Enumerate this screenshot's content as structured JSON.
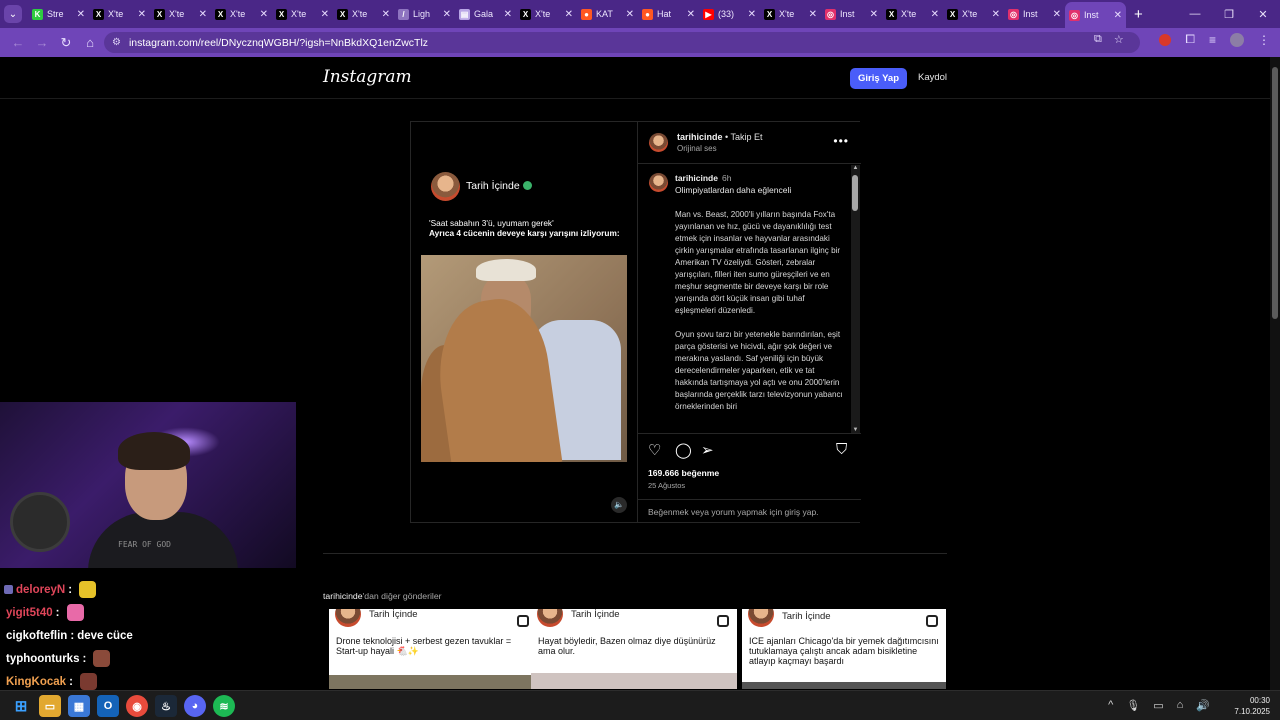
{
  "browser": {
    "tabs": [
      {
        "label": "Stre",
        "fav_color": "#2ecc40",
        "fav_glyph": "K"
      },
      {
        "label": "X'te",
        "fav_color": "#000000",
        "fav_glyph": "X"
      },
      {
        "label": "X'te",
        "fav_color": "#000000",
        "fav_glyph": "X"
      },
      {
        "label": "X'te",
        "fav_color": "#000000",
        "fav_glyph": "X"
      },
      {
        "label": "X'te",
        "fav_color": "#000000",
        "fav_glyph": "X"
      },
      {
        "label": "X'te",
        "fav_color": "#000000",
        "fav_glyph": "X"
      },
      {
        "label": "Ligh",
        "fav_color": "#8e74c0",
        "fav_glyph": "/"
      },
      {
        "label": "Gala",
        "fav_color": "#b9a6e6",
        "fav_glyph": "▤"
      },
      {
        "label": "X'te",
        "fav_color": "#000000",
        "fav_glyph": "X"
      },
      {
        "label": "KAT",
        "fav_color": "#ff5722",
        "fav_glyph": "●"
      },
      {
        "label": "Hat",
        "fav_color": "#ff5722",
        "fav_glyph": "●"
      },
      {
        "label": "(33)",
        "fav_color": "#ff0000",
        "fav_glyph": "▶"
      },
      {
        "label": "X'te",
        "fav_color": "#000000",
        "fav_glyph": "X"
      },
      {
        "label": "Inst",
        "fav_color": "#e1306c",
        "fav_glyph": "◎"
      },
      {
        "label": "X'te",
        "fav_color": "#000000",
        "fav_glyph": "X"
      },
      {
        "label": "X'te",
        "fav_color": "#000000",
        "fav_glyph": "X"
      },
      {
        "label": "Inst",
        "fav_color": "#e1306c",
        "fav_glyph": "◎"
      },
      {
        "label": "Inst",
        "fav_color": "#e1306c",
        "fav_glyph": "◎",
        "active": true
      }
    ],
    "new_tab": "+",
    "url": "instagram.com/reel/DNycznqWGBH/?igsh=NnBkdXQ1enZwcTlz"
  },
  "instagram": {
    "logo": "Instagram",
    "login_button": "Giriş Yap",
    "signup_link": "Kaydol",
    "post": {
      "media_name": "Tarih İçinde",
      "media_quote_1": "'Saat sabahın 3'ü, uyumam gerek'",
      "media_quote_2": "Ayrıca 4 cücenin deveye karşı yarışını izliyorum:",
      "username": "tarihicinde",
      "follow_text": "• Takip Et",
      "audio": "Orijinal ses",
      "caption_user": "tarihicinde",
      "caption_time": "6h",
      "caption_title": "Olimpiyatlardan daha eğlenceli",
      "caption_p1": "Man vs. Beast, 2000'li yılların başında Fox'ta yayınlanan ve hız, gücü ve dayanıklılığı test etmek için insanlar ve hayvanlar arasındaki çirkin yarışmalar etrafında tasarlanan ilginç bir Amerikan TV özeliydi. Gösteri, zebralar yarışçıları, filleri iten sumo güreşçileri ve en meşhur segmentte bir deveye karşı bir role yarışında dört küçük insan gibi tuhaf eşleşmeleri düzenledi.",
      "caption_p2": "Oyun şovu tarzı bir yetenekle barındırılan, eşit parça gösterisi ve hicivdi, ağır şok değeri ve merakına yaslandı. Saf yeniliği için büyük derecelendirmeler yaparken, etik ve tat hakkında tartışmaya yol açtı ve onu 2000'lerin başlarında gerçeklik tarzı televizyonun yabancı örneklerinden biri",
      "likes": "169.666 beğenme",
      "date": "25 Ağustos",
      "login_cta": "Beğenmek veya yorum yapmak için giriş yap."
    },
    "more_posts_user": "tarihicinde",
    "more_posts_suffix": "'dan diğer gönderiler",
    "cards": [
      {
        "name": "Tarih İçinde",
        "title": "Drone teknolojisi + serbest gezen tavuklar = Start-up hayali 🐔✨"
      },
      {
        "name": "Tarih İçinde",
        "title": "Hayat böyledir, Bazen olmaz diye düşünürüz ama olur."
      },
      {
        "name": "Tarih İçinde",
        "title": "ICE ajanları Chicago'da bir yemek dağıtımcısını tutuklamaya çalıştı ancak adam bisikletine atlayıp kaçmayı başardı"
      }
    ]
  },
  "webcam": {
    "shirt_text": "FEAR OF GOD"
  },
  "chat": [
    {
      "user": "deloreyN",
      "color": "#e0465a",
      "text": "",
      "emote": "#e6c229",
      "badge": true
    },
    {
      "user": "yigit5t40",
      "color": "#e0465a",
      "text": "",
      "emote": "#e86aa8",
      "badge": false
    },
    {
      "user": "cigkofteflin",
      "color": "#ffffff",
      "text": "deve cüce",
      "emote": "",
      "badge": false
    },
    {
      "user": "typhoonturks",
      "color": "#ffffff",
      "text": "",
      "emote": "#8a4a3a",
      "badge": false
    },
    {
      "user": "KingKocak",
      "color": "#f0a050",
      "text": "",
      "emote": "#7a3a30",
      "badge": false
    }
  ],
  "taskbar": {
    "time": "00:30",
    "date": "7.10.2025"
  }
}
